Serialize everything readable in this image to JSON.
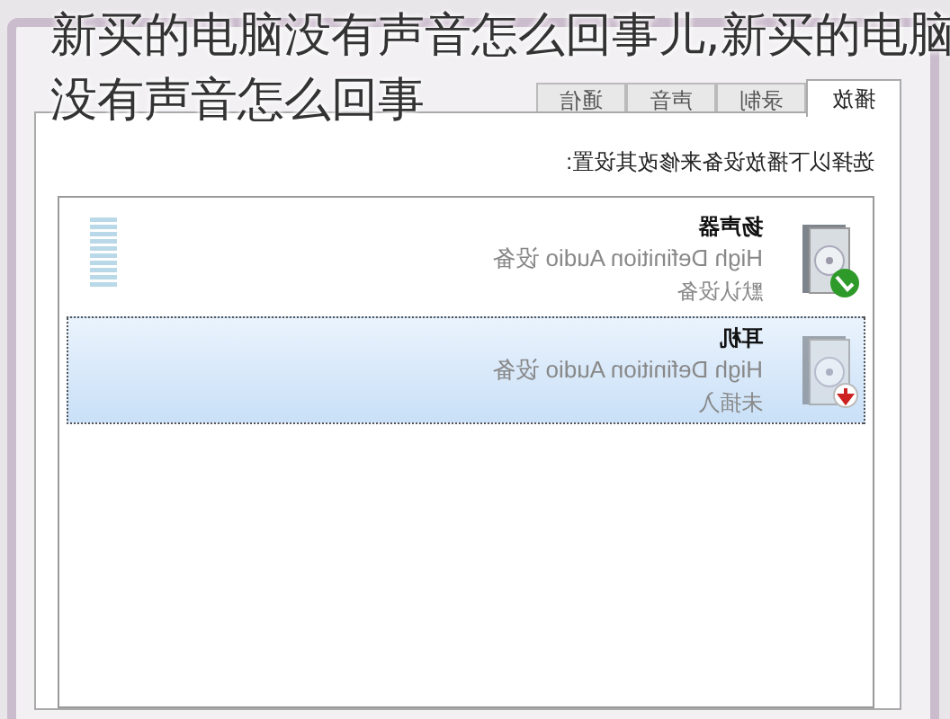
{
  "caption_lines": [
    "新买的电脑没有声音怎么回事儿,新买的电脑",
    "没有声音怎么回事"
  ],
  "tabs": [
    {
      "label": "通信",
      "selected": false
    },
    {
      "label": "声音",
      "selected": false
    },
    {
      "label": "录制",
      "selected": false
    },
    {
      "label": "播放",
      "selected": true
    }
  ],
  "instruction": "选择以下播放设备来修改其设置:",
  "devices": [
    {
      "name": "扬声器",
      "driver": "High Definition Audio 设备",
      "status": "默认设备",
      "kind": "default",
      "selected": false
    },
    {
      "name": "耳机",
      "driver": "High Definition Audio 设备",
      "status": "未插入",
      "kind": "unplugged",
      "selected": true
    }
  ]
}
